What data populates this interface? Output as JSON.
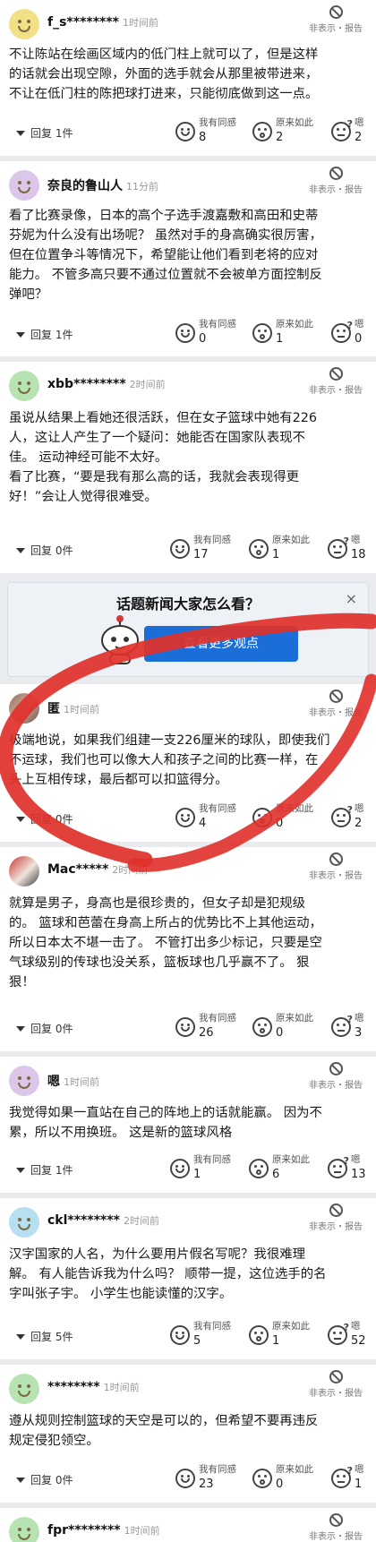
{
  "labels": {
    "hide_report": "非表示・报告",
    "agree": "我有同感",
    "interesting": "原来如此",
    "hmm": "嗯"
  },
  "comments": [
    {
      "user": "f_s********",
      "time": "1时间前",
      "lines": [
        "不让陈站在绘画区域内的低门柱上就可以了，但是这样",
        "的话就会出现空隙，外面的选手就会从那里被带进来，",
        "不让在低门柱的陈把球打进来，只能彻底做到这一点。"
      ],
      "reply": "回复 1件",
      "agree": "8",
      "interesting": "2",
      "hmm": "2"
    },
    {
      "user": "奈良的鲁山人",
      "time": "11分前",
      "lines": [
        "看了比赛录像，日本的高个子选手渡嘉敷和高田和史蒂",
        "芬妮为什么没有出场呢？ 虽然对手的身高确实很厉害，",
        "但在位置争斗等情况下，希望能让他们看到老将的应对",
        "能力。 不管多高只要不通过位置就不会被单方面控制反",
        "弹吧？"
      ],
      "reply": "回复 1件",
      "agree": "0",
      "interesting": "1",
      "hmm": "0"
    },
    {
      "user": "xbb********",
      "time": "2时间前",
      "lines": [
        "虽说从结果上看她还很活跃，但在女子篮球中她有226",
        "人，这让人产生了一个疑问：她能否在国家队表现不",
        "佳。 运动神经可能不太好。",
        "看了比赛，“要是我有那么高的话，我就会表现得更",
        "好！”会让人觉得很难受。"
      ],
      "reply": "回复 0件",
      "agree": "17",
      "interesting": "1",
      "hmm": "18"
    },
    {
      "user": "匿",
      "time": "1时间前",
      "lines": [
        "极端地说，如果我们组建一支226厘米的球队，即使我们",
        "不运球，我们也可以像大人和孩子之间的比赛一样，在",
        "头上互相传球，最后都可以扣篮得分。"
      ],
      "reply": "回复 0件",
      "agree": "4",
      "interesting": "0",
      "hmm": "2"
    },
    {
      "user": "Mac*****",
      "time": "2时间前",
      "lines": [
        "就算是男子，身高也是很珍贵的，但女子却是犯规级",
        "的。 篮球和芭蕾在身高上所占的优势比不上其他运动，",
        "所以日本太不堪一击了。 不管打出多少标记，只要是空",
        "气球级别的传球也没关系，篮板球也几乎赢不了。 狠",
        "狠！"
      ],
      "reply": "回复 0件",
      "agree": "26",
      "interesting": "0",
      "hmm": "3"
    },
    {
      "user": "嗯",
      "time": "1时间前",
      "lines": [
        "我觉得如果一直站在自己的阵地上的话就能赢。 因为不",
        "累，所以不用换班。 这是新的篮球风格"
      ],
      "reply": "回复 1件",
      "agree": "1",
      "interesting": "6",
      "hmm": "13"
    },
    {
      "user": "ckl********",
      "time": "2时间前",
      "lines": [
        "汉字国家的人名，为什么要用片假名写呢？我很难理",
        "解。 有人能告诉我为什么吗？ 顺带一提，这位选手的名",
        "字叫张子宇。 小学生也能读懂的汉字。"
      ],
      "reply": "回复 5件",
      "agree": "5",
      "interesting": "1",
      "hmm": "52"
    },
    {
      "user": "********",
      "time": "1时间前",
      "lines": [
        "遵从规则控制篮球的天空是可以的，但希望不要再违反",
        "规定侵犯领空。"
      ],
      "reply": "回复 0件",
      "agree": "23",
      "interesting": "0",
      "hmm": "1"
    },
    {
      "user": "fpr********",
      "time": "1时间前"
    }
  ],
  "promo": {
    "title": "话题新闻大家怎么看？",
    "button": "查看更多观点",
    "close": "×"
  }
}
